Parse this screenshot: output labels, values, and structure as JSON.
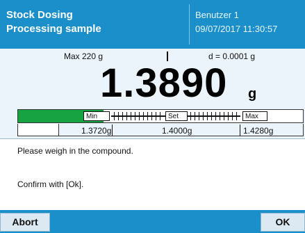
{
  "header": {
    "title_line1": "Stock Dosing",
    "title_line2": "Processing sample",
    "user": "Benutzer 1",
    "datetime": "09/07/2017 11:30:57"
  },
  "weighing": {
    "max_label": "Max 220 g",
    "readability_label": "d = 0.0001 g",
    "value": "1.3890",
    "unit": "g"
  },
  "tolerance": {
    "min_label": "Min",
    "set_label": "Set",
    "max_label": "Max",
    "lower_value": "1.3720g",
    "target_value": "1.4000g",
    "upper_value": "1.4280g",
    "fill_fraction": 0.3,
    "fill_color": "#17a342"
  },
  "message": {
    "line1": "Please weigh in the compound.",
    "line2": "Confirm with [Ok]."
  },
  "softkeys": {
    "abort_label": "Abort",
    "ok_label": "OK"
  },
  "colors": {
    "accent": "#1b8fc9",
    "display_bg": "#eaf4fa"
  }
}
